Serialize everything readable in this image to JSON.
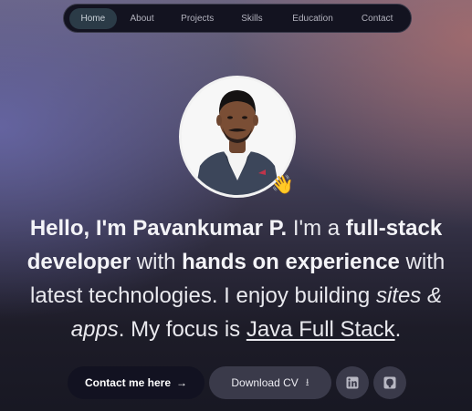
{
  "nav": {
    "items": [
      "Home",
      "About",
      "Projects",
      "Skills",
      "Education",
      "Contact"
    ],
    "active": "Home"
  },
  "hero": {
    "avatar_emoji": "👋",
    "headline": {
      "p1": "Hello, I'm Pavankumar P.",
      "p2": " I'm a ",
      "p3": "full-stack developer",
      "p4": " with ",
      "p5": "hands on experience",
      "p6": " with latest technologies. I enjoy building ",
      "p7": "sites & apps",
      "p8": ". My focus is ",
      "p9": "Java Full Stack",
      "p10": "."
    }
  },
  "buttons": {
    "contact": "Contact me here",
    "contact_arrow": "→",
    "download": "Download CV",
    "download_glyph": "⭳"
  },
  "icons": {
    "linkedin": "linkedin-icon",
    "github": "github-icon"
  },
  "colors": {
    "nav_bg": "#131320",
    "active_pill": "#2b3b47",
    "contact_bg": "#121221",
    "secondary_bg": "#3a3a4a"
  }
}
